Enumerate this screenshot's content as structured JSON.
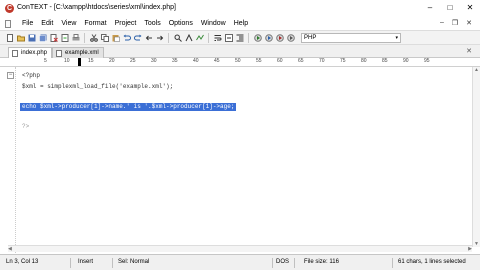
{
  "window": {
    "app_icon": "C",
    "title": "ConTEXT - [C:\\xampp\\htdocs\\series\\xml\\index.php]",
    "controls": [
      "‒",
      "□",
      "✕"
    ]
  },
  "menu": {
    "items": [
      "File",
      "Edit",
      "View",
      "Format",
      "Project",
      "Tools",
      "Options",
      "Window",
      "Help"
    ],
    "mdi_controls": [
      "‒",
      "❐",
      "✕"
    ]
  },
  "toolbar": {
    "language": "PHP",
    "language_arrow": "▾"
  },
  "tabs": [
    {
      "label": "index.php",
      "active": true
    },
    {
      "label": "example.xml",
      "active": false
    }
  ],
  "tab_close": "✕",
  "ruler": {
    "ticks": [
      "5",
      "10",
      "15",
      "20",
      "25",
      "30",
      "35",
      "40",
      "45",
      "50",
      "55",
      "60",
      "65",
      "70",
      "75",
      "80",
      "85",
      "90",
      "95"
    ]
  },
  "editor": {
    "fold_marker": "−",
    "lines": [
      "<?php",
      "$xml = simplexml_load_file('example.xml');",
      "",
      "echo $xml->producer[1]->name.' is '.$xml->producer[1]->age;",
      "",
      "?>"
    ],
    "selected_line_index": 3
  },
  "status": {
    "position": "Ln 3, Col 13",
    "mode": "Insert",
    "sel": "Sel: Normal",
    "eol": "DOS",
    "file_size": "File size: 116",
    "selection_info": "61 chars, 1 lines selected"
  },
  "colors": {
    "selection": "#3b6fd6",
    "app_icon": "#c0392b"
  }
}
